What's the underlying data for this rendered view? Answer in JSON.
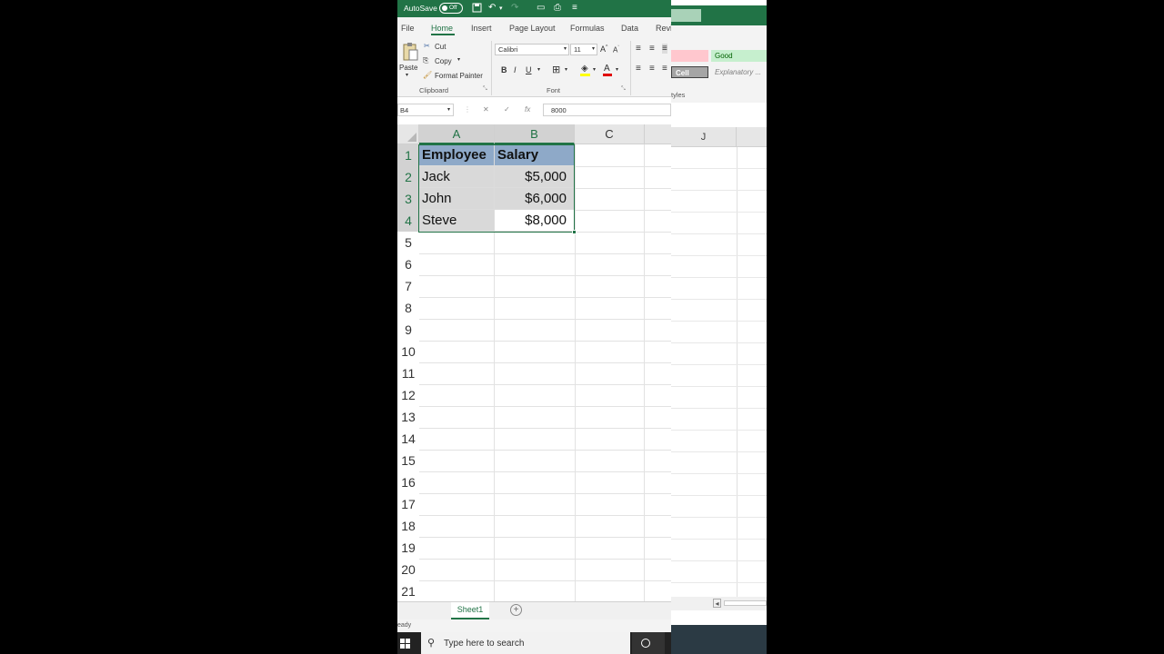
{
  "titlebar": {
    "autosave_label": "AutoSave",
    "toggle_state": "Off"
  },
  "ribbon_tabs": [
    "File",
    "Home",
    "Insert",
    "Page Layout",
    "Formulas",
    "Data",
    "Revi"
  ],
  "clipboard": {
    "paste": "Paste",
    "cut": "Cut",
    "copy": "Copy",
    "format_painter": "Format Painter",
    "group_label": "Clipboard"
  },
  "font": {
    "name": "Calibri",
    "size": "11",
    "bold": "B",
    "italic": "I",
    "underline": "U",
    "group_label": "Font"
  },
  "formula_bar": {
    "name_box": "B4",
    "fx": "fx",
    "value": "8000"
  },
  "columns": [
    "A",
    "B",
    "C"
  ],
  "rows": [
    "1",
    "2",
    "3",
    "4",
    "5",
    "6",
    "7",
    "8",
    "9",
    "10",
    "11",
    "12",
    "13",
    "14",
    "15",
    "16",
    "17",
    "18",
    "19",
    "20",
    "21"
  ],
  "table": {
    "headers": [
      "Employee",
      "Salary"
    ],
    "data": [
      [
        "Jack",
        "$5,000"
      ],
      [
        "John",
        "$6,000"
      ],
      [
        "Steve",
        "$8,000"
      ]
    ]
  },
  "sheet_tab": "Sheet1",
  "status": "eady",
  "taskbar": {
    "search_placeholder": "Type here to search"
  },
  "right_panel": {
    "styles": {
      "good": "Good",
      "cell": "Cell",
      "explanatory": "Explanatory ...",
      "group_label": "tyles"
    },
    "column": "J"
  },
  "colors": {
    "accent": "#217346",
    "header_fill": "#8ea9c8",
    "selection_fill": "#d9d9d9"
  }
}
